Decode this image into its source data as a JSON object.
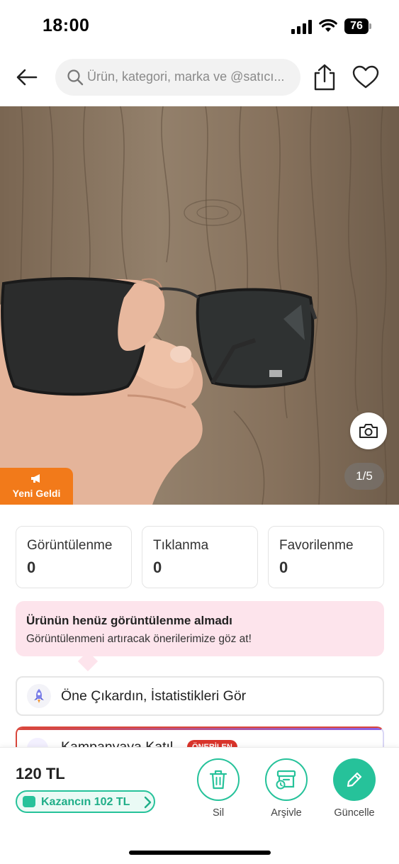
{
  "status_bar": {
    "time": "18:00",
    "battery": "76"
  },
  "header": {
    "search_placeholder": "Ürün, kategori, marka ve @satıcı..."
  },
  "product": {
    "image_counter": "1/5",
    "badge_label": "Yeni Geldi"
  },
  "stats": [
    {
      "label": "Görüntülenme",
      "value": "0"
    },
    {
      "label": "Tıklanma",
      "value": "0"
    },
    {
      "label": "Favorilenme",
      "value": "0"
    }
  ],
  "notice": {
    "title": "Ürünün henüz görüntülenme almadı",
    "text": "Görüntülenmeni artıracak önerilerimize göz at!"
  },
  "actions": [
    {
      "label": "Öne Çıkardın, İstatistikleri Gör"
    },
    {
      "label": "Kampanyaya Katıl",
      "tag": "ÖNERİLEN"
    }
  ],
  "bottom": {
    "price": "120 TL",
    "earn_label": "Kazancın 102 TL",
    "buttons": [
      {
        "label": "Sil"
      },
      {
        "label": "Arşivle"
      },
      {
        "label": "Güncelle"
      }
    ]
  },
  "colors": {
    "accent": "#26c29a",
    "badge_orange": "#f27a1a",
    "notice_bg": "#fde4ec",
    "tag_red": "#d9342b"
  }
}
